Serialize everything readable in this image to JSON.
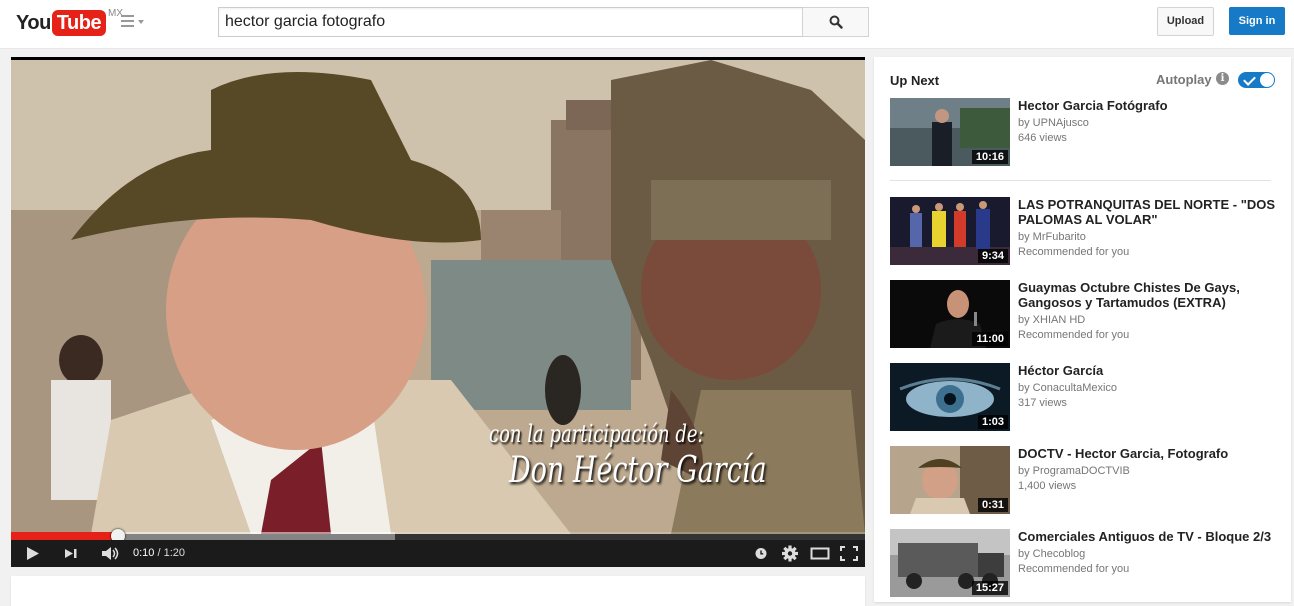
{
  "masthead": {
    "logo_you": "You",
    "logo_tube": "Tube",
    "country": "MX",
    "search_value": "hector garcia fotografo",
    "upload_label": "Upload",
    "signin_label": "Sign in"
  },
  "player": {
    "subtitle_line1": "con la participación de:",
    "subtitle_line2": "Don Héctor García",
    "current_time": "0:10",
    "separator": " / ",
    "duration": "1:20",
    "progress_fraction": 0.125,
    "buffered_fraction": 0.45
  },
  "sidebar": {
    "up_next_label": "Up Next",
    "autoplay_label": "Autoplay",
    "autoplay_on": true,
    "items": [
      {
        "title": "Hector Garcia Fotógrafo",
        "channel": "by UPNAjusco",
        "meta": "646 views",
        "duration": "10:16"
      },
      {
        "title": "LAS POTRANQUITAS DEL NORTE - \"DOS PALOMAS AL VOLAR\"",
        "channel": "by MrFubarito",
        "meta": "Recommended for you",
        "duration": "9:34"
      },
      {
        "title": "Guaymas Octubre Chistes De Gays, Gangosos y Tartamudos (EXTRA)",
        "channel": "by XHIAN HD",
        "meta": "Recommended for you",
        "duration": "11:00"
      },
      {
        "title": "Héctor García",
        "channel": "by ConacultaMexico",
        "meta": "317 views",
        "duration": "1:03"
      },
      {
        "title": "DOCTV - Hector Garcia, Fotografo",
        "channel": "by ProgramaDOCTVIB",
        "meta": "1,400 views",
        "duration": "0:31"
      },
      {
        "title": "Comerciales Antiguos de TV - Bloque 2/3",
        "channel": "by Checoblog",
        "meta": "Recommended for you",
        "duration": "15:27"
      }
    ]
  },
  "colors": {
    "brand_red": "#e62117",
    "accent_blue": "#167ac6"
  }
}
